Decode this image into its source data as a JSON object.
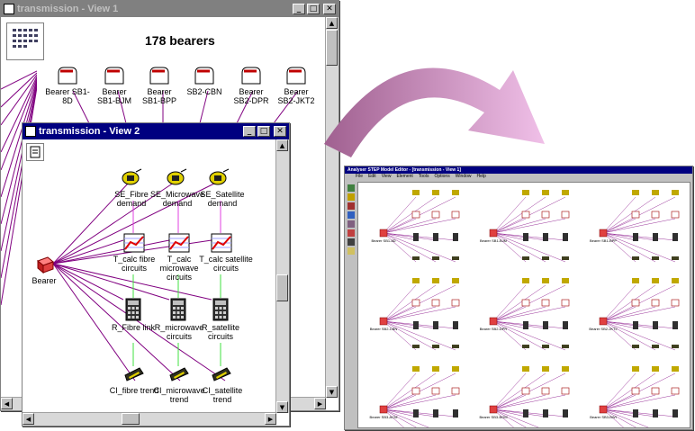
{
  "colors": {
    "accent_pink": "#e8a8d8",
    "title_active": "#000080",
    "title_inactive": "#808080",
    "link_purple": "#800080",
    "link_magenta": "#e040e0",
    "link_green": "#40e040"
  },
  "view1": {
    "title": "transmission - View 1",
    "heading": "178 bearers",
    "bearers": [
      {
        "line1": "Bearer SB1-8D",
        "line2": ""
      },
      {
        "line1": "Bearer",
        "line2": "SB1-BJM"
      },
      {
        "line1": "Bearer",
        "line2": "SB1-BPP"
      },
      {
        "line1": "SB2-CBN",
        "line2": ""
      },
      {
        "line1": "Bearer",
        "line2": "SB2-DPR"
      },
      {
        "line1": "Bearer",
        "line2": "SB2-JKT2"
      }
    ]
  },
  "view2": {
    "title": "transmission - View 2",
    "bearer_label": "Bearer",
    "demand": [
      {
        "line1": "SE_Fibre",
        "line2": "demand"
      },
      {
        "line1": "SE_Microwave",
        "line2": "demand"
      },
      {
        "line1": "SE_Satellite",
        "line2": "demand"
      }
    ],
    "calc": [
      {
        "line1": "T_calc fibre",
        "line2": "circuits",
        "line3": ""
      },
      {
        "line1": "T_calc",
        "line2": "microwave",
        "line3": "circuits"
      },
      {
        "line1": "T_calc satellite",
        "line2": "circuits",
        "line3": ""
      }
    ],
    "results": [
      {
        "line1": "R_Fibre link",
        "line2": ""
      },
      {
        "line1": "R_microwave",
        "line2": "circuits"
      },
      {
        "line1": "R_satellite",
        "line2": "circuits"
      }
    ],
    "trends": [
      {
        "line1": "CI_fibre trend",
        "line2": ""
      },
      {
        "line1": "CI_microwave",
        "line2": "trend"
      },
      {
        "line1": "CI_satellite",
        "line2": "trend"
      }
    ]
  },
  "right_window": {
    "title": "Analyser STEP Model Editor - [transmission - View 1]",
    "menu": [
      "File",
      "Edit",
      "View",
      "Element",
      "Tools",
      "Options",
      "Window",
      "Help"
    ],
    "clusters": [
      {
        "name": "Bearer SB1-8D"
      },
      {
        "name": "Bearer SB1-BJM"
      },
      {
        "name": "Bearer SB1-BPP"
      },
      {
        "name": "Bearer SB2-CBN"
      },
      {
        "name": "Bearer SB2-DPR"
      },
      {
        "name": "Bearer SB2-JKT2"
      },
      {
        "name": "Bearer SB3-ACM"
      },
      {
        "name": "Bearer SB3-BGM"
      },
      {
        "name": "Bearer SB3-BWI"
      }
    ]
  }
}
